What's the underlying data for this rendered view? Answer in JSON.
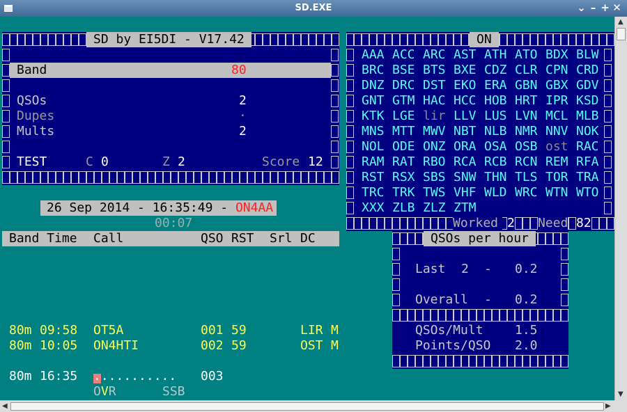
{
  "window": {
    "title": "SD.EXE",
    "buttons": [
      "⌄",
      "–",
      "+",
      "✕"
    ]
  },
  "header_panel": {
    "title": "SD by EI5DI - V17.42"
  },
  "stats": {
    "band_label": "Band",
    "band_value": "80",
    "qsos_label": "QSOs",
    "qsos_value": "2",
    "dupes_label": "Dupes",
    "dupes_value": "·",
    "mults_label": "Mults",
    "mults_value": "2",
    "test_label": "TEST",
    "c_label": "C",
    "c_value": "0",
    "z_label": "Z",
    "z_value": "2",
    "score_label": "Score",
    "score_value": "12"
  },
  "datetime": {
    "date_time": "26 Sep 2014 - 16:35:49 - ",
    "callsign": "ON4AA",
    "elapsed": "00:07"
  },
  "log_header": {
    "band_time": "Band Time",
    "call": "Call",
    "qso": "QSO",
    "rst": "RST",
    "srl": "Srl",
    "dc": "DC"
  },
  "log_entries": [
    {
      "band": "80m",
      "time": "09:58",
      "call": "OT5A",
      "qso": "001",
      "rst": "59",
      "mult": "LIR",
      "flag": "M"
    },
    {
      "band": "80m",
      "time": "10:05",
      "call": "ON4HTI",
      "qso": "002",
      "rst": "59",
      "mult": "OST",
      "flag": "M"
    }
  ],
  "entry_line": {
    "band": "80m",
    "time": "16:35",
    "call_dots": "...........",
    "qso": "003",
    "ovr_o": "O",
    "ovr_v": "V",
    "ovr_r": "R",
    "mode": "SSB"
  },
  "mult_panel": {
    "title": "ON",
    "rows": [
      [
        "AAA",
        "ACC",
        "ARC",
        "AST",
        "ATH",
        "ATO",
        "BDX",
        "BLW"
      ],
      [
        "BRC",
        "BSE",
        "BTS",
        "BXE",
        "CDZ",
        "CLR",
        "CPN",
        "CRD"
      ],
      [
        "DNZ",
        "DRC",
        "DST",
        "EKO",
        "ERA",
        "GBN",
        "GBX",
        "GDV"
      ],
      [
        "GNT",
        "GTM",
        "HAC",
        "HCC",
        "HOB",
        "HRT",
        "IPR",
        "KSD"
      ],
      [
        "KTK",
        "LGE",
        "lir",
        "LLV",
        "LUS",
        "LVN",
        "MCL",
        "MLB"
      ],
      [
        "MNS",
        "MTT",
        "MWV",
        "NBT",
        "NLB",
        "NMR",
        "NNV",
        "NOK"
      ],
      [
        "NOL",
        "ODE",
        "ONZ",
        "ORA",
        "OSA",
        "OSB",
        "ost",
        "RAC"
      ],
      [
        "RAM",
        "RAT",
        "RBO",
        "RCA",
        "RCB",
        "RCN",
        "REM",
        "RFA"
      ],
      [
        "RST",
        "RSX",
        "SBS",
        "SNW",
        "THN",
        "TLS",
        "TOR",
        "TRA"
      ],
      [
        "TRC",
        "TRK",
        "TWS",
        "VHF",
        "WLD",
        "WRC",
        "WTN",
        "WTO"
      ],
      [
        "XXX",
        "ZLB",
        "ZLZ",
        "ZTM"
      ]
    ],
    "worked_label": "Worked",
    "worked_value": "2",
    "need_label": "Need",
    "need_value": "82"
  },
  "rate_panel": {
    "title": "QSOs per hour",
    "last_label": "Last",
    "last_count": "2",
    "last_dash": "-",
    "last_rate": "0.2",
    "overall_label": "Overall",
    "overall_dash": "-",
    "overall_rate": "0.2",
    "qsos_mult_label": "QSOs/Mult",
    "qsos_mult_value": "1.5",
    "points_qso_label": "Points/QSO",
    "points_qso_value": "2.0"
  }
}
